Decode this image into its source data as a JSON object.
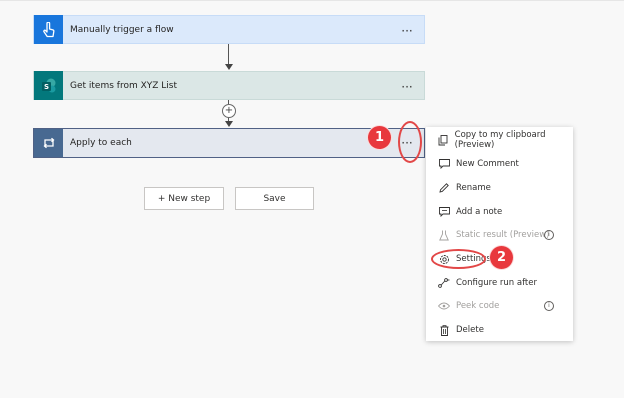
{
  "flow": {
    "trigger": {
      "title": "Manually trigger a flow",
      "icon": "hand-pointer-icon",
      "more": "···"
    },
    "get_items": {
      "title": "Get items from XYZ List",
      "icon": "sharepoint-icon",
      "icon_letter": "S",
      "more": "···"
    },
    "apply": {
      "title": "Apply to each",
      "icon": "loop-icon",
      "more": "···"
    },
    "insert_step": "+",
    "new_step_label": "+ New step",
    "save_label": "Save"
  },
  "annotations": {
    "badge_1": "1",
    "badge_2": "2"
  },
  "menu": {
    "items": [
      {
        "label": "Copy to my clipboard (Preview)",
        "icon": "copy-icon",
        "enabled": true
      },
      {
        "label": "New Comment",
        "icon": "comment-icon",
        "enabled": true
      },
      {
        "label": "Rename",
        "icon": "pencil-icon",
        "enabled": true
      },
      {
        "label": "Add a note",
        "icon": "note-icon",
        "enabled": true
      },
      {
        "label": "Static result (Preview)",
        "icon": "flask-icon",
        "enabled": false,
        "info": "i"
      },
      {
        "label": "Settings",
        "icon": "gear-icon",
        "enabled": true
      },
      {
        "label": "Configure run after",
        "icon": "run-after-icon",
        "enabled": true
      },
      {
        "label": "Peek code",
        "icon": "eye-icon",
        "enabled": false,
        "info": "i"
      },
      {
        "label": "Delete",
        "icon": "trash-icon",
        "enabled": true
      }
    ]
  },
  "colors": {
    "trigger_accent": "#1976dc",
    "sharepoint_accent": "#03787c",
    "apply_accent": "#486991",
    "badge_red": "#e8383d"
  }
}
